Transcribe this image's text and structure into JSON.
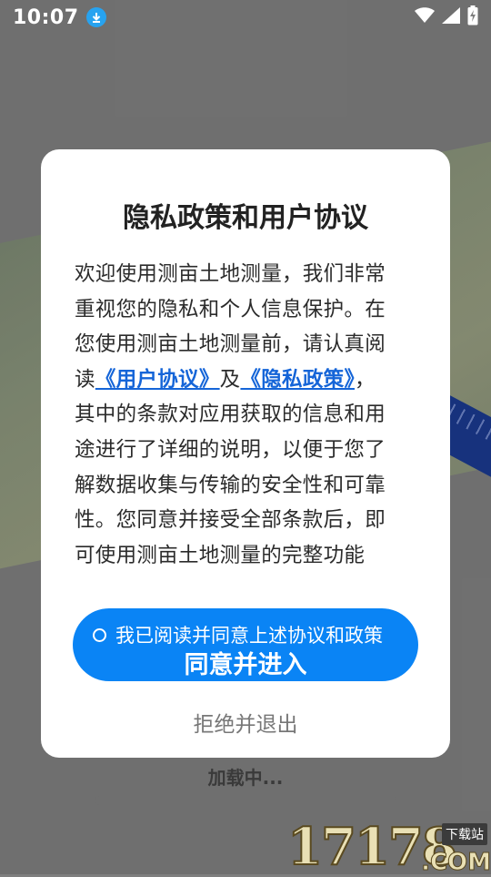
{
  "status_bar": {
    "time": "10:07",
    "icons": [
      "download-icon",
      "wifi-icon",
      "signal-icon",
      "battery-icon"
    ]
  },
  "background": {
    "loading_text": "加载中..."
  },
  "watermark": {
    "number": "17178",
    "tag": "下载站",
    "domain": ".COM"
  },
  "dialog": {
    "title": "隐私政策和用户协议",
    "body_lines": {
      "l1": "欢迎使用测亩土地测量，我们非常",
      "l2": "重视您的隐私和个人信息保护。在",
      "l3": "您使用测亩土地测量前，请认真阅",
      "l4_prefix": "读",
      "user_agreement_link": "《用户协议》",
      "l4_mid": "及",
      "privacy_policy_link": "《隐私政策》",
      "l4_suffix": "，",
      "l5": "其中的条款对应用获取的信息和用",
      "l6": "途进行了详细的说明，以便于您了",
      "l7": "解数据收集与传输的安全性和可靠",
      "l8": "性。您同意并接受全部条款后，即",
      "l9": "可使用测亩土地测量的完整功能"
    },
    "agree_checkbox_label": "我已阅读并同意上述协议和政策",
    "agree_button_label": "同意并进入",
    "refuse_label": "拒绝并退出"
  },
  "colors": {
    "primary": "#0a84f5",
    "link": "#1565d8",
    "status_badge": "#27a3f0"
  }
}
